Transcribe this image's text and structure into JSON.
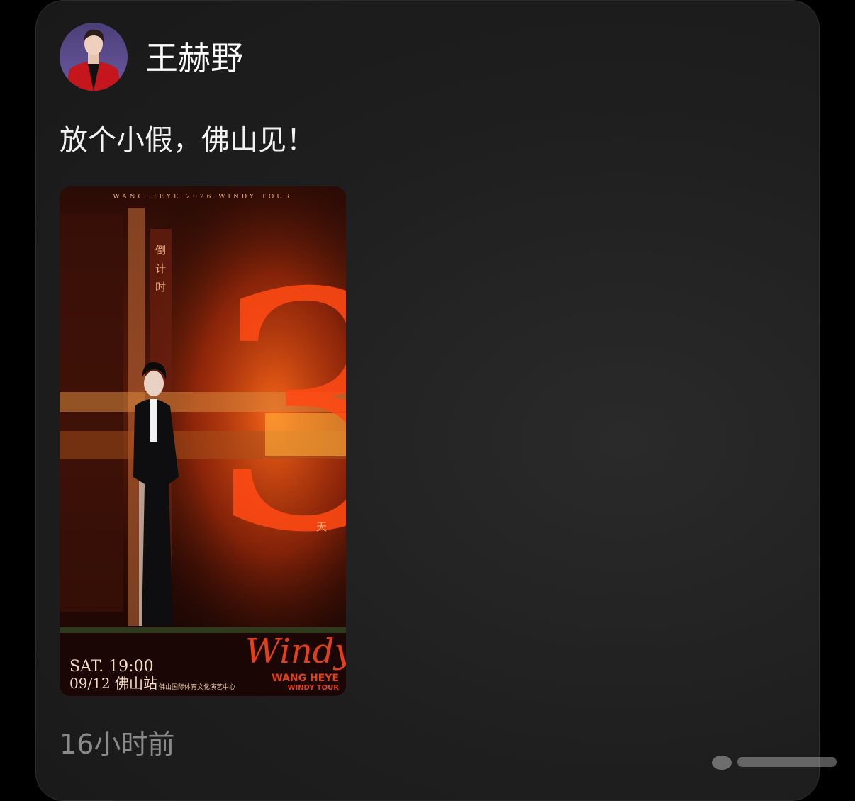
{
  "author": {
    "name": "王赫野",
    "avatar_icon": "avatar-photo"
  },
  "post": {
    "text": "放个小假，佛山见！",
    "time": "16小时前"
  },
  "poster": {
    "tour_header": "WANG HEYE 2026 WINDY TOUR",
    "countdown_label": "倒计时",
    "countdown_number": "3",
    "countdown_unit": "天",
    "date_line1": "SAT. 19:00",
    "date_line2": "09/12 佛山站",
    "venue": "佛山国际体育文化演艺中心",
    "script_title": "Windy",
    "brand_line1": "WANG HEYE",
    "brand_line2": "WINDY TOUR",
    "accent_color": "#e3401a"
  }
}
